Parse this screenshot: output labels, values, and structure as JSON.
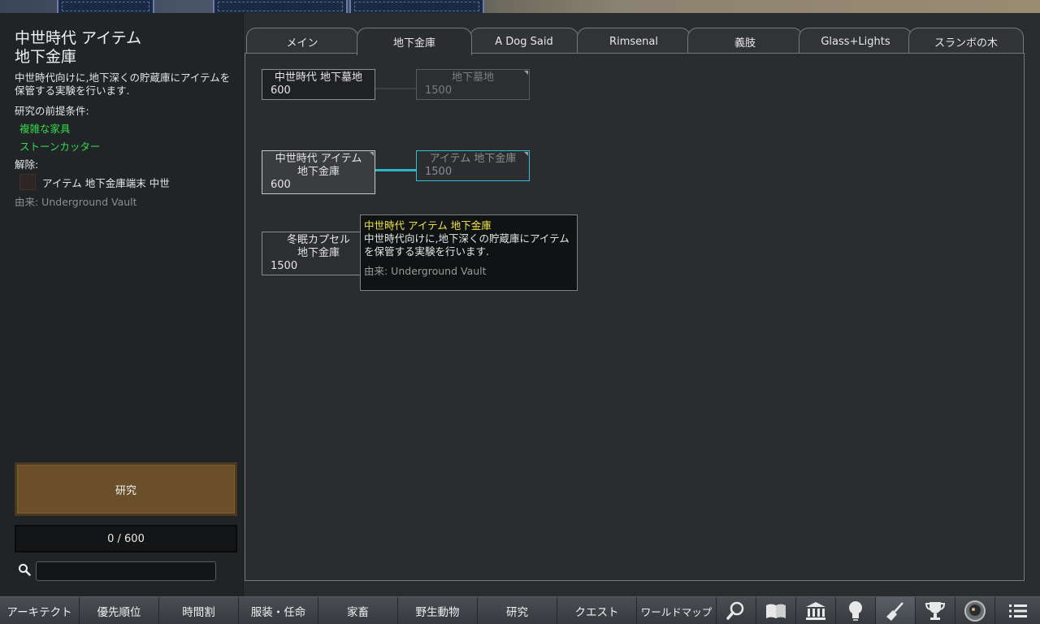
{
  "left_panel": {
    "title_line1": "中世時代 アイテム",
    "title_line2": "地下金庫",
    "description": "中世時代向けに,地下深くの貯蔵庫にアイテムを保管する実験を行います.",
    "prereq_label": "研究の前提条件:",
    "prerequisites": [
      "複雑な家具",
      "ストーンカッター"
    ],
    "unlock_label": "解除:",
    "unlocks": [
      {
        "label": "アイテム 地下金庫端末 中世",
        "icon": "unlock-item-icon"
      }
    ],
    "source": "由来:  Underground Vault",
    "research_button": "研究",
    "progress": "0 / 600",
    "search_placeholder": ""
  },
  "tabs": [
    {
      "label": "メイン",
      "active": false
    },
    {
      "label": "地下金庫",
      "active": true
    },
    {
      "label": "A Dog Said",
      "active": false
    },
    {
      "label": "Rimsenal",
      "active": false
    },
    {
      "label": "義肢",
      "active": false
    },
    {
      "label": "Glass+Lights",
      "active": false
    },
    {
      "label": "スランボの木",
      "active": false
    }
  ],
  "nodes": {
    "n1": {
      "title": "中世時代 地下墓地",
      "cost": "600"
    },
    "n2": {
      "title": "地下墓地",
      "cost": "1500"
    },
    "n3": {
      "title_line1": "中世時代 アイテム",
      "title_line2": "地下金庫",
      "cost": "600"
    },
    "n4": {
      "title": "アイテム 地下金庫",
      "cost": "1500"
    },
    "n5": {
      "title_line1": "冬眠カプセル",
      "title_line2": "地下金庫",
      "cost": "1500"
    }
  },
  "tooltip": {
    "title": "中世時代 アイテム 地下金庫",
    "description": "中世時代向けに,地下深くの貯蔵庫にアイテムを保管する実験を行います.",
    "source": "由来: Underground Vault"
  },
  "bottom_bar": {
    "buttons": [
      "アーキテクト",
      "優先順位",
      "時間割",
      "服装・任命",
      "家畜",
      "野生動物",
      "研究",
      "クエスト",
      "ワールドマップ"
    ],
    "icons": [
      "magnifier-icon",
      "book-icon",
      "museum-icon",
      "lightbulb-icon",
      "broom-icon",
      "trophy-icon",
      "astronaut-icon",
      "menu-list-icon"
    ]
  },
  "colors": {
    "prereq_green": "#34d94c",
    "tooltip_title_yellow": "#f2e24a",
    "active_link_cyan": "#2bb7c7",
    "research_button_brown": "#6b4f2b"
  }
}
